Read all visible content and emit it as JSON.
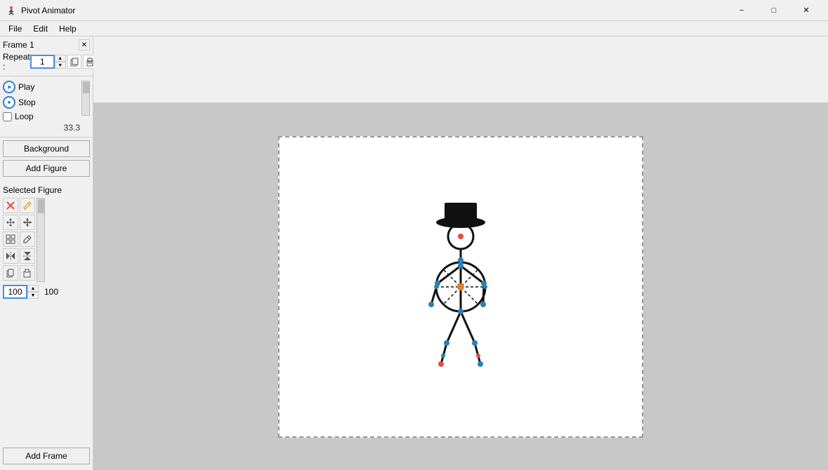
{
  "titleBar": {
    "appName": "Pivot Animator",
    "minimize": "−",
    "maximize": "□",
    "close": "✕"
  },
  "menuBar": {
    "items": [
      "File",
      "Edit",
      "Help"
    ]
  },
  "frames": {
    "frameLabel": "Frame 1",
    "repeatLabel": "Repeat :",
    "repeatValue": "1"
  },
  "controls": {
    "playLabel": "Play",
    "stopLabel": "Stop",
    "loopLabel": "Loop",
    "fpsValue": "33.3"
  },
  "buttons": {
    "background": "Background",
    "addFigure": "Add Figure",
    "addFrame": "Add Frame"
  },
  "selectedFigure": {
    "label": "Selected Figure"
  },
  "sizeInput": {
    "value": "100",
    "max": "100"
  }
}
